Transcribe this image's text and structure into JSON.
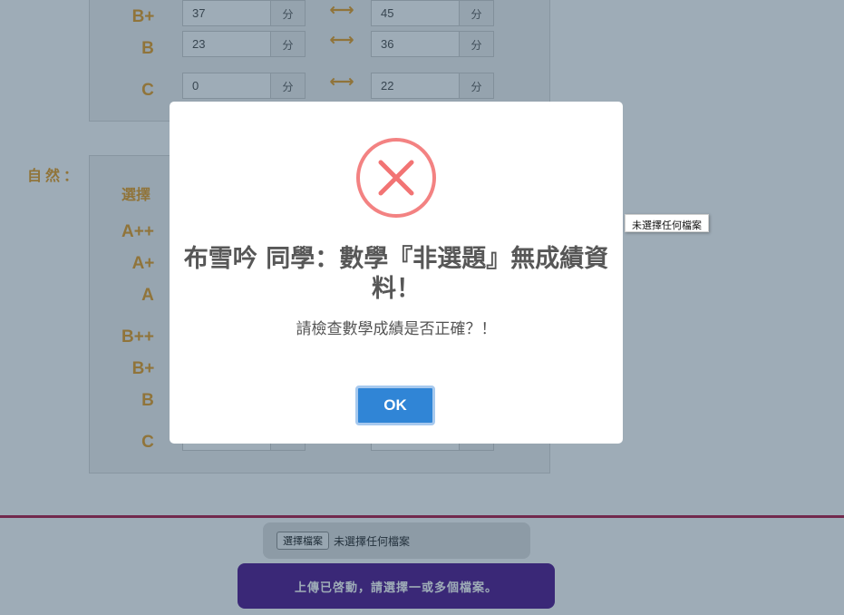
{
  "form": {
    "unit": "分",
    "arrow_glyph": "⟷",
    "upper_rows": [
      {
        "grade": "B+",
        "min": "37",
        "max": "45"
      },
      {
        "grade": "B",
        "min": "23",
        "max": "36"
      },
      {
        "grade": "C",
        "min": "0",
        "max": "22"
      }
    ],
    "nature_section": {
      "label": "自然：",
      "column_label": "選擇",
      "grades": [
        "A++",
        "A+",
        "A",
        "B++",
        "B+",
        "B",
        "C"
      ]
    }
  },
  "file_upload": {
    "button_label": "選擇檔案",
    "status_text": "未選擇任何檔案",
    "tooltip": "未選擇任何檔案"
  },
  "upload_banner": {
    "text": "上傳已啓動，請選擇一或多個檔案。"
  },
  "modal": {
    "icon": "error-x-icon",
    "title": "布雪吟 同學：數學『非選題』無成績資料！",
    "text": "請檢查數學成績是否正確？！",
    "confirm_label": "OK"
  },
  "colors": {
    "grade_label": "#e69a1c",
    "confirm_button": "#3085d6",
    "error_icon": "#f27474",
    "upload_banner": "#4a0f8a",
    "divider": "#b0123e"
  }
}
